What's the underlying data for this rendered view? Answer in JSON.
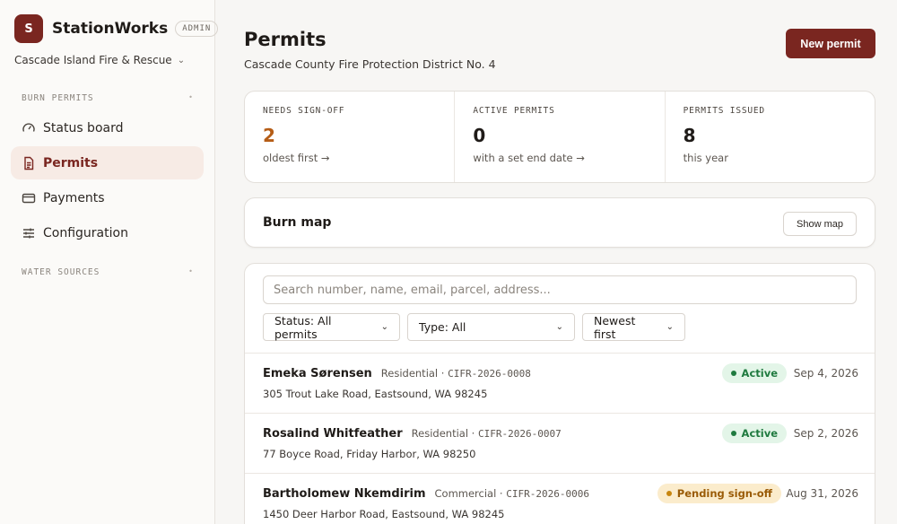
{
  "app": {
    "logo_letter": "S",
    "name": "StationWorks",
    "role_badge": "ADMIN",
    "org": "Cascade Island Fire & Rescue"
  },
  "sidebar": {
    "sections": [
      {
        "label": "BURN PERMITS"
      },
      {
        "label": "WATER SOURCES"
      }
    ],
    "items": [
      {
        "label": "Status board",
        "icon": "gauge-icon"
      },
      {
        "label": "Permits",
        "icon": "document-icon",
        "active": true
      },
      {
        "label": "Payments",
        "icon": "credit-card-icon"
      },
      {
        "label": "Configuration",
        "icon": "sliders-icon"
      }
    ]
  },
  "header": {
    "title": "Permits",
    "subtitle": "Cascade County Fire Protection District No. 4",
    "new_button": "New permit"
  },
  "stats": [
    {
      "label": "NEEDS SIGN-OFF",
      "value": "2",
      "note": "oldest first →"
    },
    {
      "label": "ACTIVE PERMITS",
      "value": "0",
      "note": "with a set end date →"
    },
    {
      "label": "PERMITS ISSUED",
      "value": "8",
      "note": "this year"
    }
  ],
  "map": {
    "title": "Burn map",
    "button": "Show map"
  },
  "filters": {
    "search_placeholder": "Search number, name, email, parcel, address...",
    "status": "Status: All permits",
    "type": "Type: All",
    "sort": "Newest first"
  },
  "permits": [
    {
      "name": "Emeka Sørensen",
      "type": "Residential",
      "number": "CIFR-2026-0008",
      "address": "305 Trout Lake Road, Eastsound, WA 98245",
      "status": "Active",
      "date": "Sep 4, 2026"
    },
    {
      "name": "Rosalind Whitfeather",
      "type": "Residential",
      "number": "CIFR-2026-0007",
      "address": "77 Boyce Road, Friday Harbor, WA 98250",
      "status": "Active",
      "date": "Sep 2, 2026"
    },
    {
      "name": "Bartholomew Nkemdirim",
      "type": "Commercial",
      "number": "CIFR-2026-0006",
      "address": "1450 Deer Harbor Road, Eastsound, WA 98245",
      "status": "Pending sign-off",
      "date": "Aug 31, 2026"
    }
  ],
  "colors": {
    "brand": "#7a2620",
    "active_bg": "#f7ebe5",
    "active_badge": "#1f7a3f",
    "pending_badge": "#9a5b06",
    "warn_value": "#b55d16"
  }
}
